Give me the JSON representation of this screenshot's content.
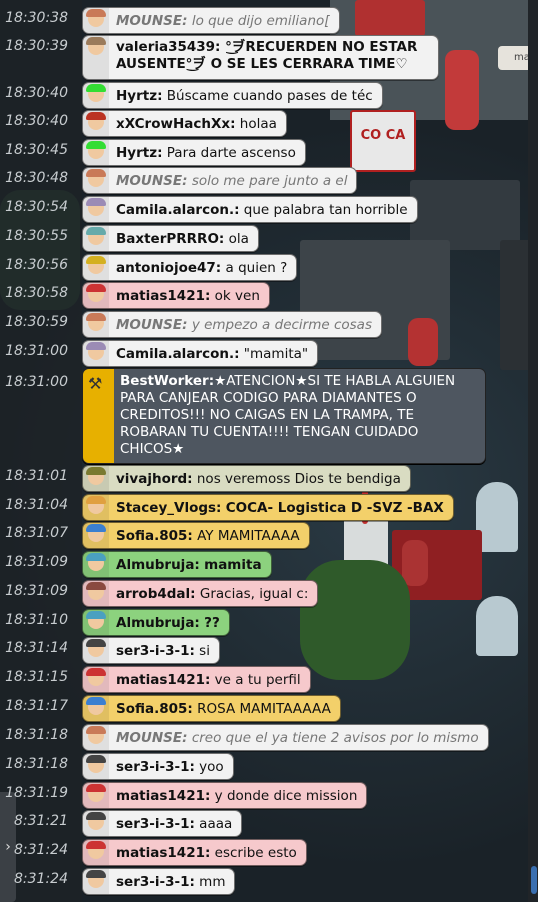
{
  "chat": {
    "messages": [
      {
        "time": "18:30:38",
        "user": "MOUNSE:",
        "text": "lo que dijo emiliano[",
        "color": "white",
        "system": true,
        "avatar": "#c97a58"
      },
      {
        "time": "18:30:39",
        "user": "valeria35439:",
        "text": "°͜ヺRECUERDEN NO ESTAR AUSENTE°͜ヺ O SE LES CERRARA TIME♡",
        "color": "white",
        "system": false,
        "avatar": "#9b7b5b",
        "multi": true
      },
      {
        "time": "18:30:40",
        "user": "Hyrtz:",
        "text": "Búscame cuando pases de téc",
        "color": "white",
        "system": false,
        "avatar": "#3d3"
      },
      {
        "time": "18:30:40",
        "user": "xXCrowHachXx:",
        "text": "holaa",
        "color": "white",
        "system": false,
        "avatar": "#b32"
      },
      {
        "time": "18:30:45",
        "user": "Hyrtz:",
        "text": "Para darte ascenso",
        "color": "white",
        "system": false,
        "avatar": "#3d3"
      },
      {
        "time": "18:30:48",
        "user": "MOUNSE:",
        "text": "solo me pare junto a el",
        "color": "white",
        "system": true,
        "avatar": "#c97a58"
      },
      {
        "time": "18:30:54",
        "user": "Camila.alarcon.:",
        "text": "que palabra tan horrible",
        "color": "white",
        "system": false,
        "avatar": "#9b8bb5"
      },
      {
        "time": "18:30:55",
        "user": "BaxterPRRRO:",
        "text": "ola",
        "color": "white",
        "system": false,
        "avatar": "#6aa"
      },
      {
        "time": "18:30:56",
        "user": "antoniojoe47:",
        "text": "a quien ?",
        "color": "white",
        "system": false,
        "avatar": "#d4b020"
      },
      {
        "time": "18:30:58",
        "user": "matias1421:",
        "text": "ok ven",
        "color": "pink",
        "system": false,
        "avatar": "#c33"
      },
      {
        "time": "18:30:59",
        "user": "MOUNSE:",
        "text": "y empezo a decirme cosas",
        "color": "white",
        "system": true,
        "avatar": "#c97a58"
      },
      {
        "time": "18:31:00",
        "user": "Camila.alarcon.:",
        "text": "\"mamita\"",
        "color": "white",
        "system": false,
        "avatar": "#9b8bb5"
      },
      {
        "time": "18:31:01",
        "user": "vivajhord:",
        "text": "nos veremoss Dios te bendiga",
        "color": "olive",
        "system": false,
        "avatar": "#7a7a30"
      },
      {
        "time": "18:31:04",
        "user": "Stacey_Vlogs:",
        "text": "COCA- Logistica D -SVZ -BAX",
        "color": "yellow",
        "system": false,
        "avatar": "#e0a040",
        "boldbody": true
      },
      {
        "time": "18:31:07",
        "user": "Sofia.805:",
        "text": "AY MAMITAAAA",
        "color": "yellow",
        "system": false,
        "avatar": "#3b7fd0"
      },
      {
        "time": "18:31:09",
        "user": "Almubruja:",
        "text": "mamita",
        "color": "green",
        "system": false,
        "avatar": "#4aa0c0",
        "boldbody": true
      },
      {
        "time": "18:31:09",
        "user": "arrob4dal:",
        "text": "Gracias, igual c:",
        "color": "pink",
        "system": false,
        "avatar": "#8a4a40"
      },
      {
        "time": "18:31:10",
        "user": "Almubruja:",
        "text": "??",
        "color": "green",
        "system": false,
        "avatar": "#4aa0c0",
        "boldbody": true
      },
      {
        "time": "18:31:14",
        "user": "ser3-i-3-1:",
        "text": "si",
        "color": "white",
        "system": false,
        "avatar": "#444"
      },
      {
        "time": "18:31:15",
        "user": "matias1421:",
        "text": "ve a tu perfil",
        "color": "pink",
        "system": false,
        "avatar": "#c33"
      },
      {
        "time": "18:31:17",
        "user": "Sofia.805:",
        "text": "ROSA MAMITAAAAA",
        "color": "yellow",
        "system": false,
        "avatar": "#3b7fd0"
      },
      {
        "time": "18:31:18",
        "user": "MOUNSE:",
        "text": "creo que el ya tiene 2 avisos por lo mismo",
        "color": "white",
        "system": true,
        "avatar": "#c97a58"
      },
      {
        "time": "18:31:18",
        "user": "ser3-i-3-1:",
        "text": "yoo",
        "color": "white",
        "system": false,
        "avatar": "#444"
      },
      {
        "time": "18:31:19",
        "user": "matias1421:",
        "text": "y donde dice mission",
        "color": "pink",
        "system": false,
        "avatar": "#c33"
      },
      {
        "time": "8:31:21",
        "user": "ser3-i-3-1:",
        "text": "aaaa",
        "color": "white",
        "system": false,
        "avatar": "#444"
      },
      {
        "time": "8:31:24",
        "user": "matias1421:",
        "text": "escribe esto",
        "color": "pink",
        "system": false,
        "avatar": "#c33"
      },
      {
        "time": "8:31:24",
        "user": "ser3-i-3-1:",
        "text": "mm",
        "color": "white",
        "system": false,
        "avatar": "#444"
      }
    ],
    "bot": {
      "time": "18:31:00",
      "user": "BestWorker:",
      "text": "★ATENCION★SI TE HABLA ALGUIEN PARA CANJEAR CODIGO PARA DIAMANTES O CREDITOS!!! NO CAIGAS EN LA TRAMPA, TE ROBARAN TU CUENTA!!!! TENGAN CUIDADO CHICOS★"
    }
  },
  "room": {
    "sign_text": "CO CA",
    "tag_text": "ma"
  },
  "ui": {
    "expand_icon": "chevron-right-icon"
  },
  "colors": {
    "bubble_white": "#f2f2f2",
    "bubble_pink": "#f6c9cc",
    "bubble_yellow": "#f3d06a",
    "bubble_green": "#8cd27e",
    "bubble_olive": "#d9dcc2",
    "bot_strip": "#e7b000",
    "bot_bg": "#4e5660"
  }
}
